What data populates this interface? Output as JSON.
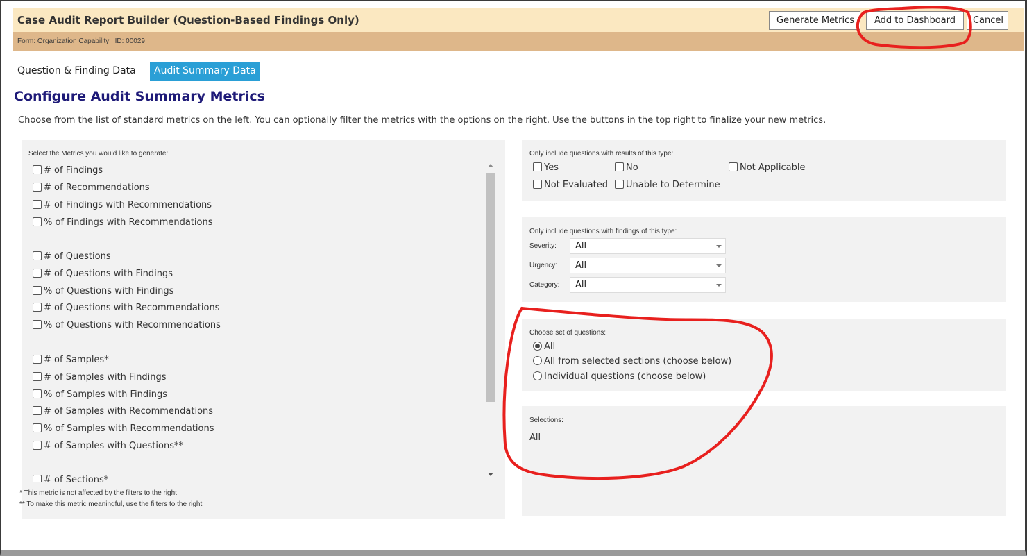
{
  "header": {
    "title": "Case Audit Report Builder (Question-Based Findings Only)",
    "subtitle": "Form: Organization Capability   ID: 00029",
    "buttons": {
      "generate": "Generate Metrics",
      "add": "Add to Dashboard",
      "cancel": "Cancel"
    }
  },
  "tabs": [
    {
      "label": "Question & Finding Data",
      "active": false
    },
    {
      "label": "Audit Summary Data",
      "active": true
    }
  ],
  "heading": "Configure Audit Summary Metrics",
  "intro": "Choose from the list of standard metrics on the left. You can optionally filter the metrics with the options on the right. Use the buttons in the top right to finalize your new metrics.",
  "metrics": {
    "label": "Select the Metrics you would like to generate:",
    "items": [
      "# of Findings",
      "# of Recommendations",
      "# of Findings with Recommendations",
      "% of Findings with Recommendations",
      "# of Questions",
      "# of Questions with Findings",
      "% of Questions with Findings",
      "# of Questions with Recommendations",
      "% of Questions with Recommendations",
      "# of Samples*",
      "# of Samples with Findings",
      "% of Samples with Findings",
      "# of Samples with Recommendations",
      "% of Samples with Recommendations",
      "# of Samples with Questions**",
      "# of Sections*"
    ],
    "footnote1": "* This metric is not affected by the filters to the right",
    "footnote2": "** To make this metric meaningful, use the filters to the right"
  },
  "results_filter": {
    "label": "Only include questions with results of this type:",
    "options": [
      "Yes",
      "No",
      "Not Applicable",
      "Not Evaluated",
      "Unable to Determine"
    ]
  },
  "findings_filter": {
    "label": "Only include questions with findings of this type:",
    "fields": [
      {
        "label": "Severity:",
        "value": "All"
      },
      {
        "label": "Urgency:",
        "value": "All"
      },
      {
        "label": "Category:",
        "value": "All"
      }
    ]
  },
  "question_set": {
    "label": "Choose set of questions:",
    "options": [
      "All",
      "All from selected sections (choose below)",
      "Individual questions (choose below)"
    ],
    "selected": "All"
  },
  "selections": {
    "label": "Selections:",
    "value": "All"
  },
  "annotation_color": "#e8201e"
}
